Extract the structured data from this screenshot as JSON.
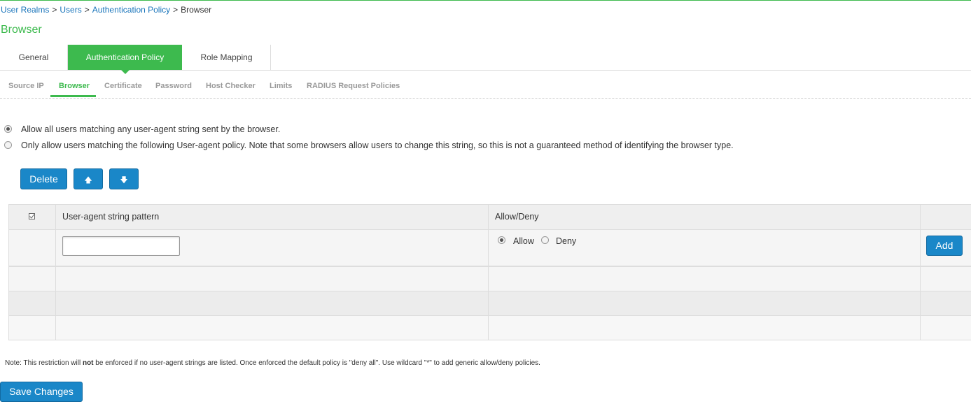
{
  "breadcrumb": {
    "items": [
      "User Realms",
      "Users",
      "Authentication Policy"
    ],
    "separator": ">",
    "current": "Browser"
  },
  "page": {
    "title": "Browser"
  },
  "tabs": [
    {
      "label": "General",
      "active": false
    },
    {
      "label": "Authentication Policy",
      "active": true
    },
    {
      "label": "Role Mapping",
      "active": false
    }
  ],
  "subtabs": [
    {
      "label": "Source IP",
      "active": false
    },
    {
      "label": "Browser",
      "active": true
    },
    {
      "label": "Certificate",
      "active": false
    },
    {
      "label": "Password",
      "active": false
    },
    {
      "label": "Host Checker",
      "active": false
    },
    {
      "label": "Limits",
      "active": false
    },
    {
      "label": "RADIUS Request Policies",
      "active": false
    }
  ],
  "policy": {
    "options": [
      {
        "label": "Allow all users matching any user-agent string sent by the browser.",
        "selected": true
      },
      {
        "label": "Only allow users matching the following User-agent policy. Note that some browsers allow users to change this string, so this is not a guaranteed method of identifying the browser type.",
        "selected": false
      }
    ]
  },
  "toolbar": {
    "delete_label": "Delete",
    "up_icon": "arrow-up-icon",
    "down_icon": "arrow-down-icon",
    "up_glyph": "🡅",
    "down_glyph": "🡇"
  },
  "table": {
    "select_all_icon": "checkbox-icon",
    "columns": [
      "User-agent string pattern",
      "Allow/Deny"
    ],
    "new_row": {
      "pattern_value": "",
      "allow_label": "Allow",
      "deny_label": "Deny",
      "allow_selected": true,
      "add_label": "Add"
    },
    "rows": []
  },
  "note": {
    "prefix": "Note: This restriction will ",
    "bold": "not",
    "suffix": " be enforced if no user-agent strings are listed. Once enforced the default policy is \"deny all\". Use wildcard \"*\" to add generic allow/deny policies."
  },
  "footer": {
    "save_label": "Save Changes"
  },
  "colors": {
    "accent": "#3dba4e",
    "link": "#1a75bb",
    "button": "#1a87c8"
  }
}
